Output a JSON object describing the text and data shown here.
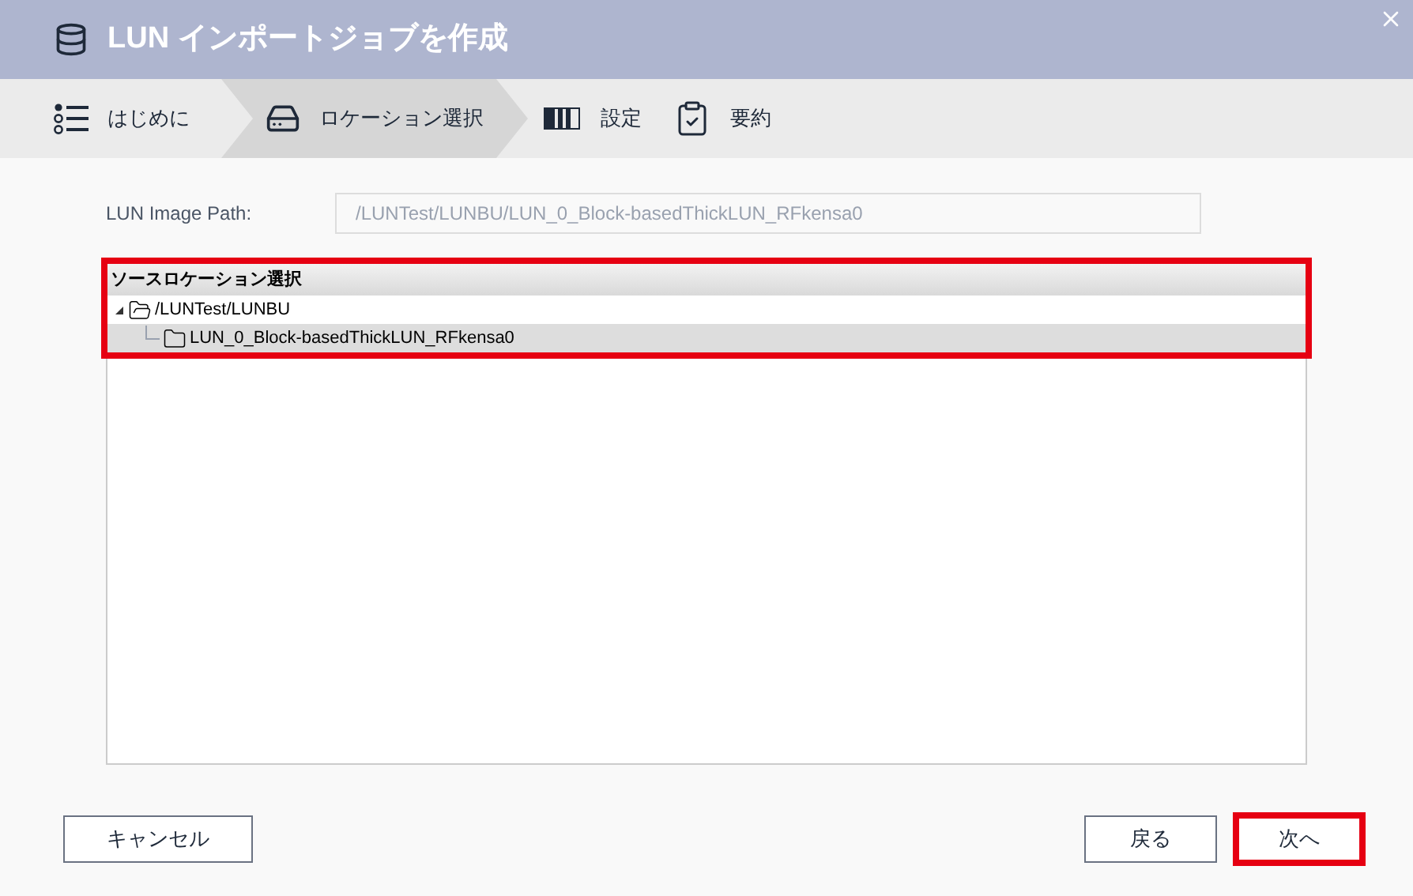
{
  "window": {
    "title": "LUN インポートジョブを作成"
  },
  "steps": [
    {
      "label": "はじめに",
      "kind": "list",
      "selected": false
    },
    {
      "label": "ロケーション選択",
      "kind": "drive",
      "selected": true
    },
    {
      "label": "設定",
      "kind": "bars",
      "selected": false
    },
    {
      "label": "要約",
      "kind": "clipboard",
      "selected": false
    }
  ],
  "image_path": {
    "label": "LUN Image Path:",
    "value": "/LUNTest/LUNBU/LUN_0_Block-basedThickLUN_RFkensa0",
    "disabled": true
  },
  "tree": {
    "header": "ソースロケーション選択",
    "highlighted": true,
    "items": [
      {
        "label": "/LUNTest/LUNBU",
        "expanded": true,
        "selected": false,
        "children": [
          {
            "label": "LUN_0_Block-basedThickLUN_RFkensa0",
            "selected": true
          }
        ]
      }
    ]
  },
  "buttons": [
    {
      "label": "キャンセル",
      "kind": "cancel",
      "highlighted": false
    },
    {
      "label": "戻る",
      "kind": "back",
      "highlighted": false
    },
    {
      "label": "次へ",
      "kind": "next",
      "highlighted": true
    }
  ]
}
